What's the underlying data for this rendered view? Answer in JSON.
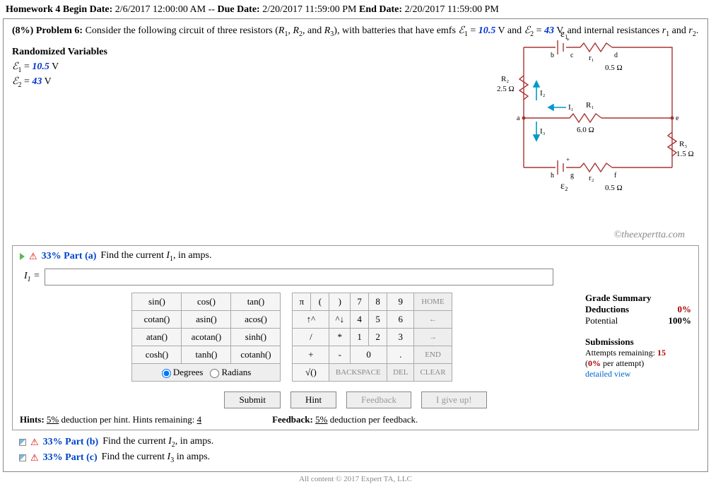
{
  "header": {
    "hw_label": "Homework 4 Begin Date:",
    "begin": "2/6/2017 12:00:00 AM",
    "sep": "--",
    "due_label": "Due Date:",
    "due": "2/20/2017 11:59:00 PM",
    "end_label": "End Date:",
    "end": "2/20/2017 11:59:00 PM"
  },
  "problem": {
    "pct": "(8%) Problem 6:",
    "text1": "Consider the following circuit of three resistors (",
    "r1": "R",
    "s1": "1",
    "c1": ", ",
    "r2": "R",
    "s2": "2",
    "c2": ", and ",
    "r3": "R",
    "s3": "3",
    "text2": "), with batteries that have emfs ",
    "e1sym": "ℰ",
    "e1sub": "1",
    "e1eq": " = ",
    "e1val": "10.5",
    "vand": " V and ",
    "e2sym": "ℰ",
    "e2sub": "2",
    "e2eq": " = ",
    "e2val": "43",
    "text3": " V, and internal resistances ",
    "ri1": "r",
    "ri1s": "1",
    "and2": " and ",
    "ri2": "r",
    "ri2s": "2",
    "dot": "."
  },
  "randvars": {
    "title": "Randomized Variables",
    "l1a": "ℰ",
    "l1b": "1",
    "l1c": " = ",
    "l1v": "10.5",
    "l1u": " V",
    "l2a": "ℰ",
    "l2b": "2",
    "l2c": " = ",
    "l2v": "43",
    "l2u": " V"
  },
  "copyright": "©theexpertta.com",
  "partA": {
    "pct": "33%",
    "label": "Part (a)",
    "text1": "Find the current ",
    "ivar": "I",
    "isub": "1",
    "text2": ", in amps.",
    "eqlabel_var": "I",
    "eqlabel_sub": "1",
    "eqlabel_eq": " = ",
    "input_value": ""
  },
  "funcpad": {
    "r1": [
      "sin()",
      "cos()",
      "tan()"
    ],
    "r2": [
      "cotan()",
      "asin()",
      "acos()"
    ],
    "r3": [
      "atan()",
      "acotan()",
      "sinh()"
    ],
    "r4": [
      "cosh()",
      "tanh()",
      "cotanh()"
    ],
    "mode_deg": "Degrees",
    "mode_rad": "Radians"
  },
  "numpad": {
    "r1": [
      "π",
      "(",
      ")",
      "7",
      "8",
      "9",
      "HOME"
    ],
    "r2": [
      "↑^",
      "^↓",
      "4",
      "5",
      "6",
      "←"
    ],
    "r3": [
      "/",
      "*",
      "1",
      "2",
      "3",
      "→"
    ],
    "r4": [
      "+",
      "-",
      "0",
      ".",
      "END"
    ],
    "r5": [
      "√()",
      "BACKSPACE",
      "DEL",
      "CLEAR"
    ]
  },
  "grade": {
    "title": "Grade Summary",
    "ded_label": "Deductions",
    "ded_val": "0%",
    "pot_label": "Potential",
    "pot_val": "100%",
    "sub_title": "Submissions",
    "att_label": "Attempts remaining: ",
    "att_val": "15",
    "per_attempt": "(0% per attempt)",
    "detailed": "detailed view"
  },
  "actions": {
    "submit": "Submit",
    "hint": "Hint",
    "feedback": "Feedback",
    "giveup": "I give up!"
  },
  "hints": {
    "h_label": "Hints:",
    "h_pct": "5%",
    "h_text": " deduction per hint. Hints remaining: ",
    "h_rem": "4",
    "f_label": "Feedback:",
    "f_pct": "5%",
    "f_text": " deduction per feedback."
  },
  "partB": {
    "pct": "33%",
    "label": "Part (b)",
    "text1": "Find the current ",
    "ivar": "I",
    "isub": "2",
    "text2": ", in amps."
  },
  "partC": {
    "pct": "33%",
    "label": "Part (c)",
    "text1": "Find the current ",
    "ivar": "I",
    "isub": "3",
    "text2": " in amps."
  },
  "footer": "All content © 2017 Expert TA, LLC",
  "circuit": {
    "e1": "ε₁",
    "e2": "ε₂",
    "r1": "R₁",
    "r1v": "6.0 Ω",
    "r2": "R₂",
    "r2v": "2.5 Ω",
    "r3": "R₃",
    "r3v": "1.5 Ω",
    "sr1": "r₁",
    "sr1v": "0.5 Ω",
    "sr2": "r₂",
    "sr2v": "0.5 Ω",
    "i1": "I₁",
    "i2": "I₂",
    "i3": "I₃",
    "a": "a",
    "b": "b",
    "c": "c",
    "d": "d",
    "e": "e",
    "f": "f",
    "g": "g",
    "h": "h"
  }
}
